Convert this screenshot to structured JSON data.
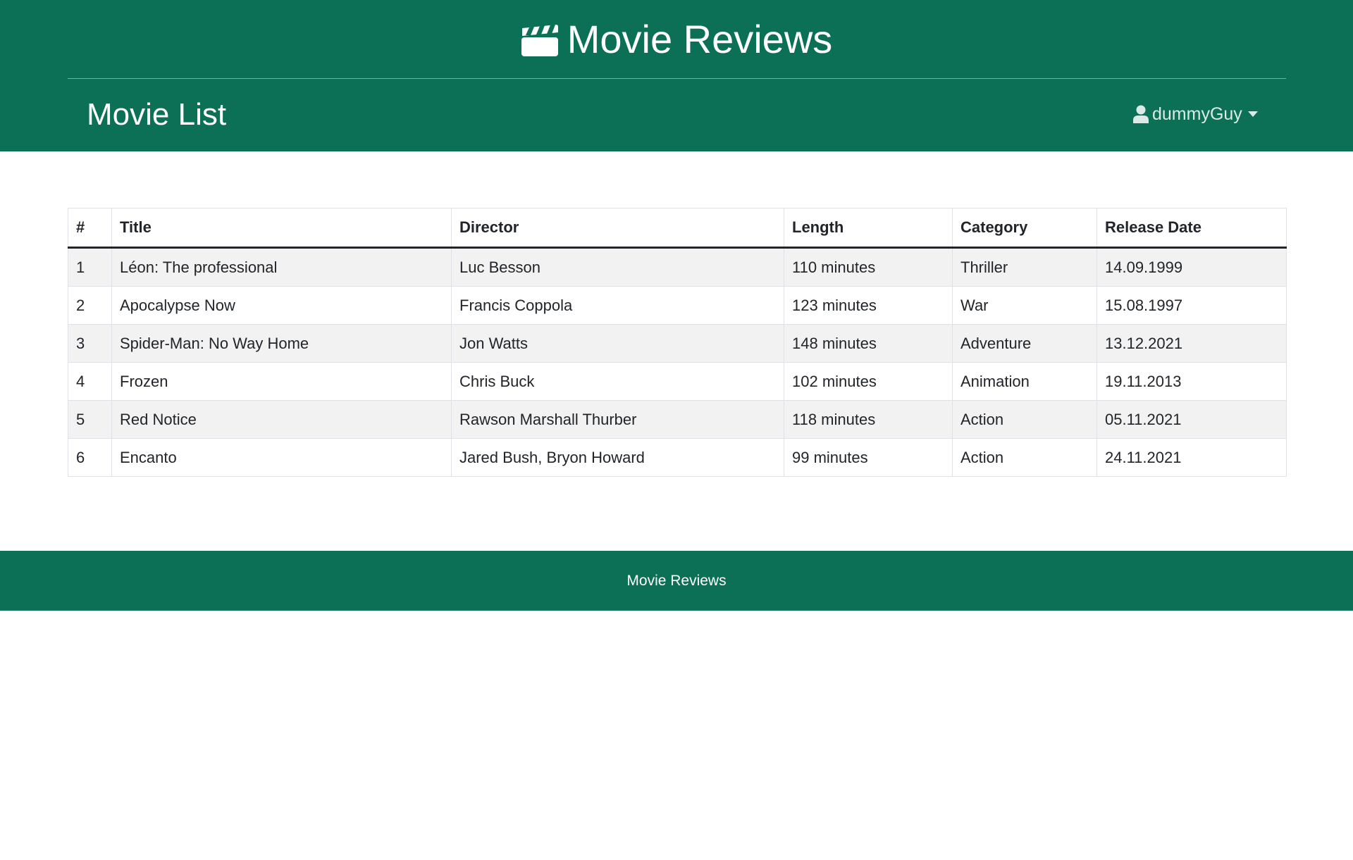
{
  "header": {
    "brand_icon": "clapperboard-icon",
    "brand_title": "Movie Reviews",
    "page_title": "Movie List",
    "user": {
      "icon": "user-icon",
      "name": "dummyGuy",
      "dropdown_icon": "caret-down-icon"
    }
  },
  "movies_table": {
    "columns": [
      "#",
      "Title",
      "Director",
      "Length",
      "Category",
      "Release Date"
    ],
    "rows": [
      [
        "1",
        "Léon: The professional",
        "Luc Besson",
        "110 minutes",
        "Thriller",
        "14.09.1999"
      ],
      [
        "2",
        "Apocalypse Now",
        "Francis Coppola",
        "123 minutes",
        "War",
        "15.08.1997"
      ],
      [
        "3",
        "Spider-Man: No Way Home",
        "Jon Watts",
        "148 minutes",
        "Adventure",
        "13.12.2021"
      ],
      [
        "4",
        "Frozen",
        "Chris Buck",
        "102 minutes",
        "Animation",
        "19.11.2013"
      ],
      [
        "5",
        "Red Notice",
        "Rawson Marshall Thurber",
        "118 minutes",
        "Action",
        "05.11.2021"
      ],
      [
        "6",
        "Encanto",
        "Jared Bush, Bryon Howard",
        "99 minutes",
        "Action",
        "24.11.2021"
      ]
    ]
  },
  "footer": {
    "text": "Movie Reviews"
  },
  "colors": {
    "brand_green": "#0b7056",
    "striped_row": "#f2f2f2",
    "text": "#212529"
  }
}
